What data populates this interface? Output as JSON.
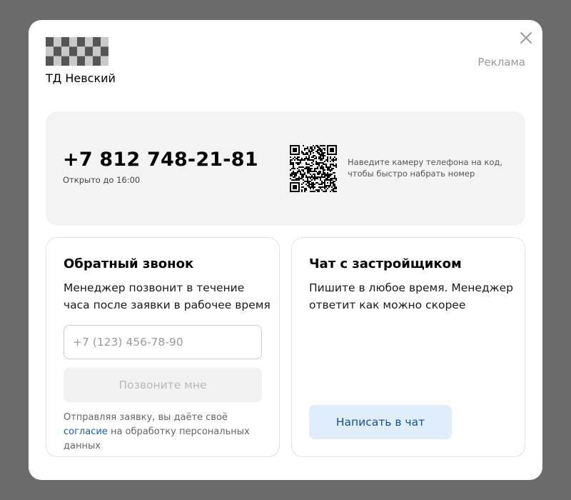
{
  "header": {
    "company_name": "ТД Невский",
    "ad_label": "Реклама",
    "logo_icon": "checkered-flag-logo",
    "close_icon": "close-icon"
  },
  "phone_panel": {
    "phone_number": "+7 812 748-21-81",
    "open_hours": "Открыто до 16:00",
    "qr_icon": "qr-code-icon",
    "qr_hint": "Наведите камеру телефона на код, чтобы быстро набрать номер"
  },
  "callback": {
    "title": "Обратный звонок",
    "description": "Менеджер позвонит в течение часа после заявки в рабочее время",
    "phone_placeholder": "+7 (123) 456-78-90",
    "phone_value": "",
    "submit_label": "Позвоните мне",
    "consent_text": "Отправляя заявку, вы даёте своё ",
    "consent_link": "согласие",
    "consent_tail": " на обработку персональных данных"
  },
  "chat": {
    "title": "Чат с застройщиком",
    "description": "Пишите в любое время. Менеджер ответит как можно скорее",
    "button_label": "Написать в чат"
  },
  "colors": {
    "overlay": "#6b6b6b",
    "panel_bg": "#f3f3f3",
    "link": "#1a5fb4",
    "chat_button_bg": "#e0edfb",
    "chat_button_text": "#1a4d9c",
    "disabled_button_bg": "#f2f2f2"
  }
}
